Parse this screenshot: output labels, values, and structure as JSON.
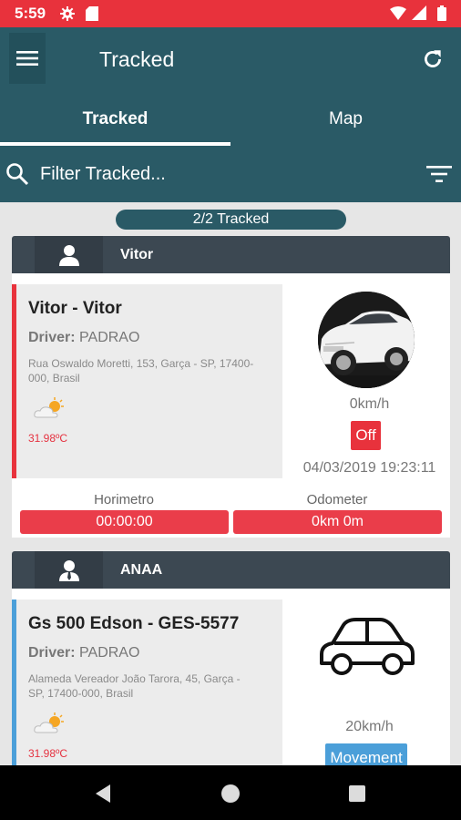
{
  "status_bar": {
    "time": "5:59"
  },
  "app_bar": {
    "title": "Tracked"
  },
  "tabs": [
    {
      "label": "Tracked",
      "active": true
    },
    {
      "label": "Map",
      "active": false
    }
  ],
  "filter": {
    "placeholder": "Filter Tracked..."
  },
  "count_label": "2/2 Tracked",
  "groups": [
    {
      "name": "Vitor",
      "icon": "person-icon",
      "vehicle": {
        "name": "Vitor - Vitor",
        "driver_label": "Driver:",
        "driver_name": "PADRAO",
        "address": "Rua Oswaldo Moretti, 153, Garça - SP, 17400-000, Brasil",
        "temperature": "31.98ºC",
        "speed": "0km/h",
        "state": "Off",
        "state_color": "#e8323c",
        "timestamp": "04/03/2019 19:23:11",
        "accent_color": "#e8323c",
        "image": "white-sedan-photo"
      },
      "metrics": [
        {
          "label": "Horimetro",
          "value": "00:00:00"
        },
        {
          "label": "Odometer",
          "value": "0km 0m"
        }
      ]
    },
    {
      "name": "ANAA",
      "icon": "person-tie-icon",
      "vehicle": {
        "name": "Gs 500 Edson - GES-5577",
        "driver_label": "Driver:",
        "driver_name": "PADRAO",
        "address": "Alameda Vereador João Tarora, 45, Garça - SP, 17400-000, Brasil",
        "temperature": "31.98ºC",
        "speed": "20km/h",
        "state": "Movement",
        "state_color": "#4b9fd9",
        "accent_color": "#4b9fd9",
        "image": "car-outline-icon"
      }
    }
  ],
  "colors": {
    "primary": "#2a5a66",
    "status_bar": "#e8323c",
    "accent_red": "#ea3d4a",
    "accent_blue": "#4b9fd9"
  }
}
